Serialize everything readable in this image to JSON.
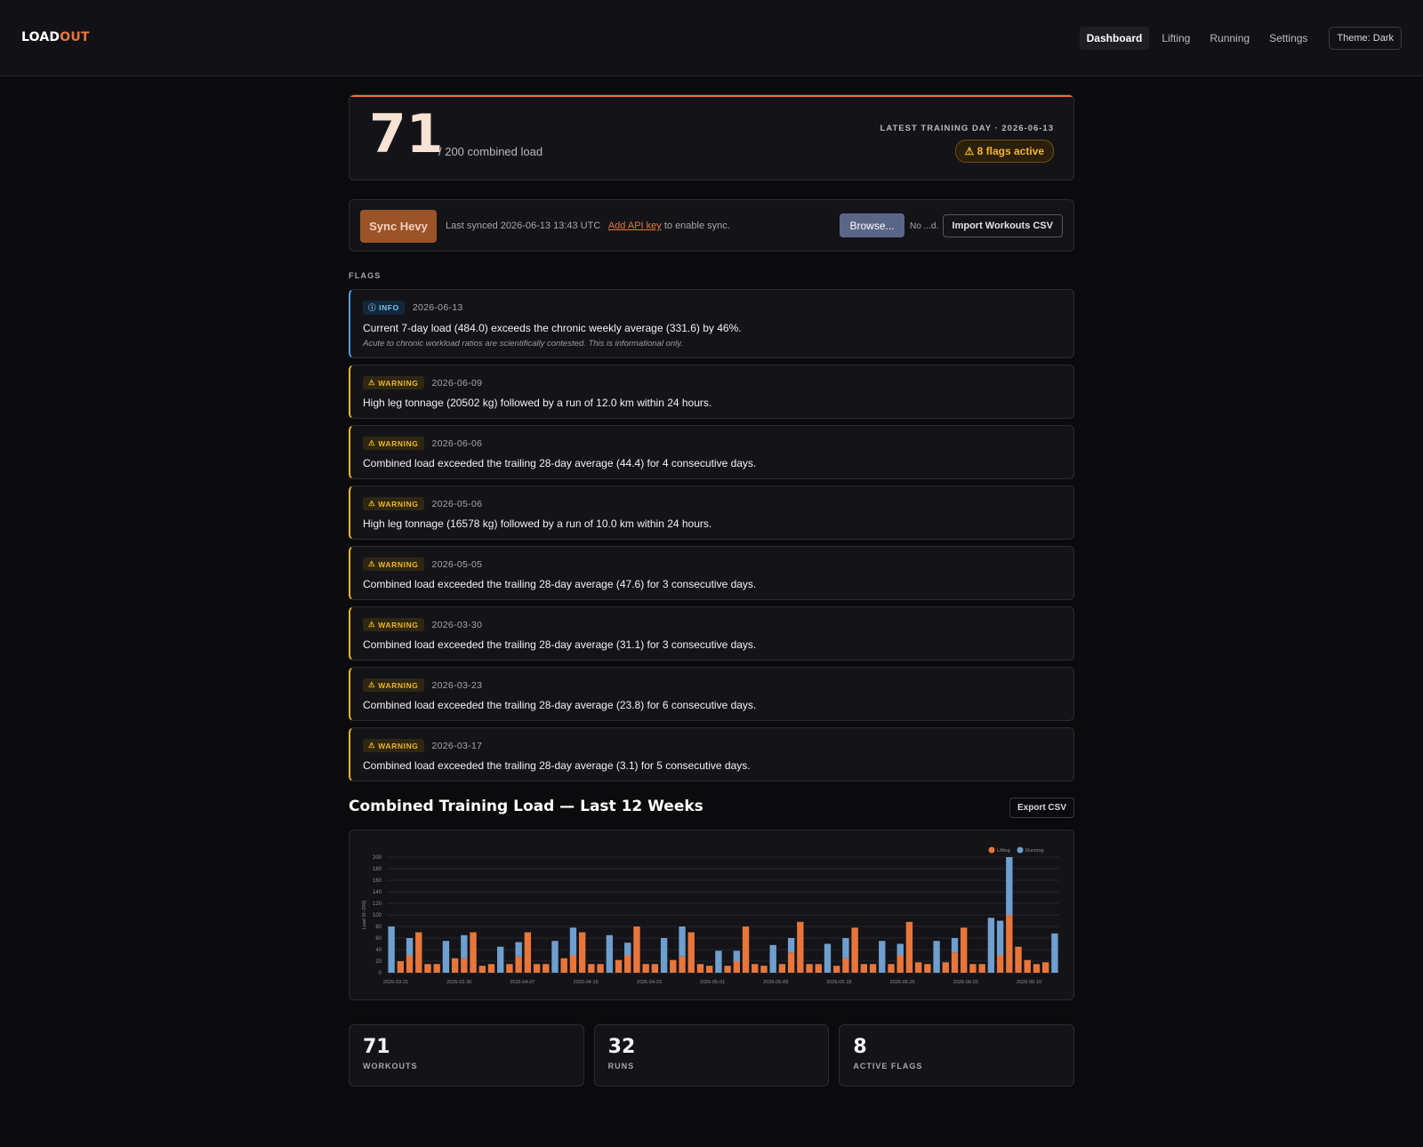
{
  "app": {
    "logo_part1": "LOAD",
    "logo_part2": "OUT",
    "nav": [
      "Dashboard",
      "Lifting",
      "Running",
      "Settings"
    ],
    "theme_label": "Theme: Dark",
    "accent_color": "#e8763a"
  },
  "hero": {
    "score": "71",
    "score_suffix": "/ 200 combined load",
    "latest_label": "LATEST TRAINING DAY · 2026-06-13",
    "flags_badge": "⚠ 8 flags active"
  },
  "sync": {
    "button": "Sync Hevy",
    "last_synced": "Last synced 2026-06-13 13:43 UTC",
    "add_key_link": "Add API key",
    "add_key_suffix": " to enable sync.",
    "browse": "Browse...",
    "file_name": "No ...d.",
    "import": "Import Workouts CSV"
  },
  "flags_label": "FLAGS",
  "flags": [
    {
      "level": "INFO",
      "icon": "info-icon",
      "date": "2026-06-13",
      "message": "Current 7-day load (484.0) exceeds the chronic weekly average (331.6) by 46%.",
      "note": "Acute to chronic workload ratios are scientifically contested. This is informational only."
    },
    {
      "level": "WARNING",
      "icon": "warning-icon",
      "date": "2026-06-09",
      "message": "High leg tonnage (20502 kg) followed by a run of 12.0 km within 24 hours."
    },
    {
      "level": "WARNING",
      "icon": "warning-icon",
      "date": "2026-06-06",
      "message": "Combined load exceeded the trailing 28-day average (44.4) for 4 consecutive days."
    },
    {
      "level": "WARNING",
      "icon": "warning-icon",
      "date": "2026-05-06",
      "message": "High leg tonnage (16578 kg) followed by a run of 10.0 km within 24 hours."
    },
    {
      "level": "WARNING",
      "icon": "warning-icon",
      "date": "2026-05-05",
      "message": "Combined load exceeded the trailing 28-day average (47.6) for 3 consecutive days."
    },
    {
      "level": "WARNING",
      "icon": "warning-icon",
      "date": "2026-03-30",
      "message": "Combined load exceeded the trailing 28-day average (31.1) for 3 consecutive days."
    },
    {
      "level": "WARNING",
      "icon": "warning-icon",
      "date": "2026-03-23",
      "message": "Combined load exceeded the trailing 28-day average (23.8) for 6 consecutive days."
    },
    {
      "level": "WARNING",
      "icon": "warning-icon",
      "date": "2026-03-17",
      "message": "Combined load exceeded the trailing 28-day average (3.1) for 5 consecutive days."
    }
  ],
  "chart_section": {
    "title": "Combined Training Load — Last 12 Weeks",
    "export": "Export CSV"
  },
  "chart_data": {
    "type": "bar",
    "stacked": true,
    "ylabel": "Load (0–200)",
    "ylim": [
      0,
      200
    ],
    "yticks": [
      0,
      20,
      40,
      60,
      80,
      100,
      120,
      140,
      160,
      180,
      200
    ],
    "xtick_labels": [
      "2026-03-21",
      "2026-03-30",
      "2026-04-07",
      "2026-04-15",
      "2026-04-23",
      "2026-05-01",
      "2026-05-09",
      "2026-05-18",
      "2026-05-26",
      "2026-06-03",
      "2026-06-10"
    ],
    "legend": "top-right",
    "grid": true,
    "series": [
      {
        "name": "Lifting",
        "color": "#e8763a",
        "values": [
          0,
          20,
          30,
          70,
          15,
          15,
          0,
          25,
          25,
          70,
          12,
          15,
          0,
          15,
          28,
          70,
          15,
          15,
          0,
          25,
          30,
          70,
          15,
          15,
          0,
          22,
          30,
          80,
          15,
          15,
          0,
          22,
          28,
          70,
          15,
          12,
          0,
          12,
          20,
          80,
          15,
          12,
          0,
          15,
          35,
          88,
          15,
          15,
          0,
          12,
          25,
          78,
          15,
          15,
          0,
          15,
          30,
          88,
          18,
          15,
          0,
          18,
          35,
          78,
          15,
          15,
          0,
          30,
          100,
          45,
          22,
          15,
          18,
          0
        ]
      },
      {
        "name": "Running",
        "color": "#6e9fcf",
        "values": [
          80,
          0,
          30,
          0,
          0,
          0,
          55,
          0,
          40,
          0,
          0,
          0,
          45,
          0,
          25,
          0,
          0,
          0,
          55,
          0,
          48,
          0,
          0,
          0,
          65,
          0,
          22,
          0,
          0,
          0,
          60,
          0,
          52,
          0,
          0,
          0,
          38,
          0,
          18,
          0,
          0,
          0,
          48,
          0,
          25,
          0,
          0,
          0,
          50,
          0,
          35,
          0,
          0,
          0,
          55,
          0,
          20,
          0,
          0,
          0,
          55,
          0,
          25,
          0,
          0,
          0,
          95,
          60,
          100,
          0,
          0,
          0,
          0,
          68
        ]
      }
    ]
  },
  "stats": [
    {
      "value": "71",
      "label": "WORKOUTS"
    },
    {
      "value": "32",
      "label": "RUNS"
    },
    {
      "value": "8",
      "label": "ACTIVE FLAGS"
    }
  ]
}
